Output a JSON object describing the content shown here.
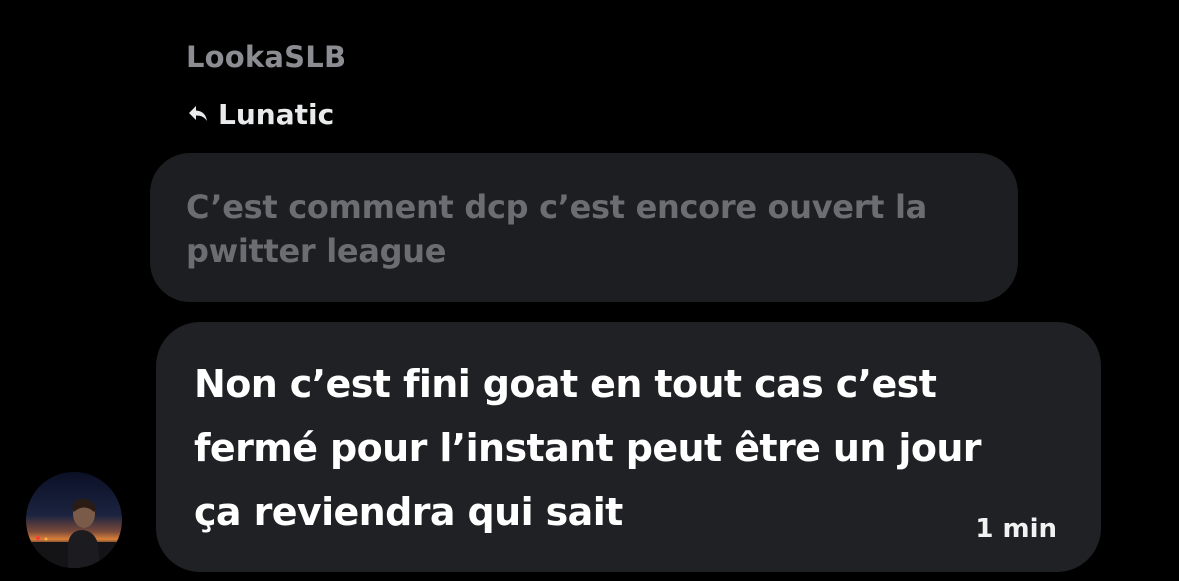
{
  "conversation": {
    "sender_name": "LookaSLB",
    "reply_to": {
      "label": "Lunatic",
      "icon": "reply-arrow-icon"
    },
    "quoted_message": {
      "text": "C’est comment dcp c’est encore ouvert la pwitter league"
    },
    "message": {
      "text": "Non c’est fini goat en tout cas c’est fermé pour l’instant peut être un jour ça reviendra qui sait",
      "timestamp": "1 min"
    }
  },
  "colors": {
    "background": "#000000",
    "quoted_bubble": "#1d1e22",
    "message_bubble": "#202125",
    "sender_name": "#8b8d92",
    "quoted_text": "#6b6d72",
    "message_text": "#ffffff"
  }
}
